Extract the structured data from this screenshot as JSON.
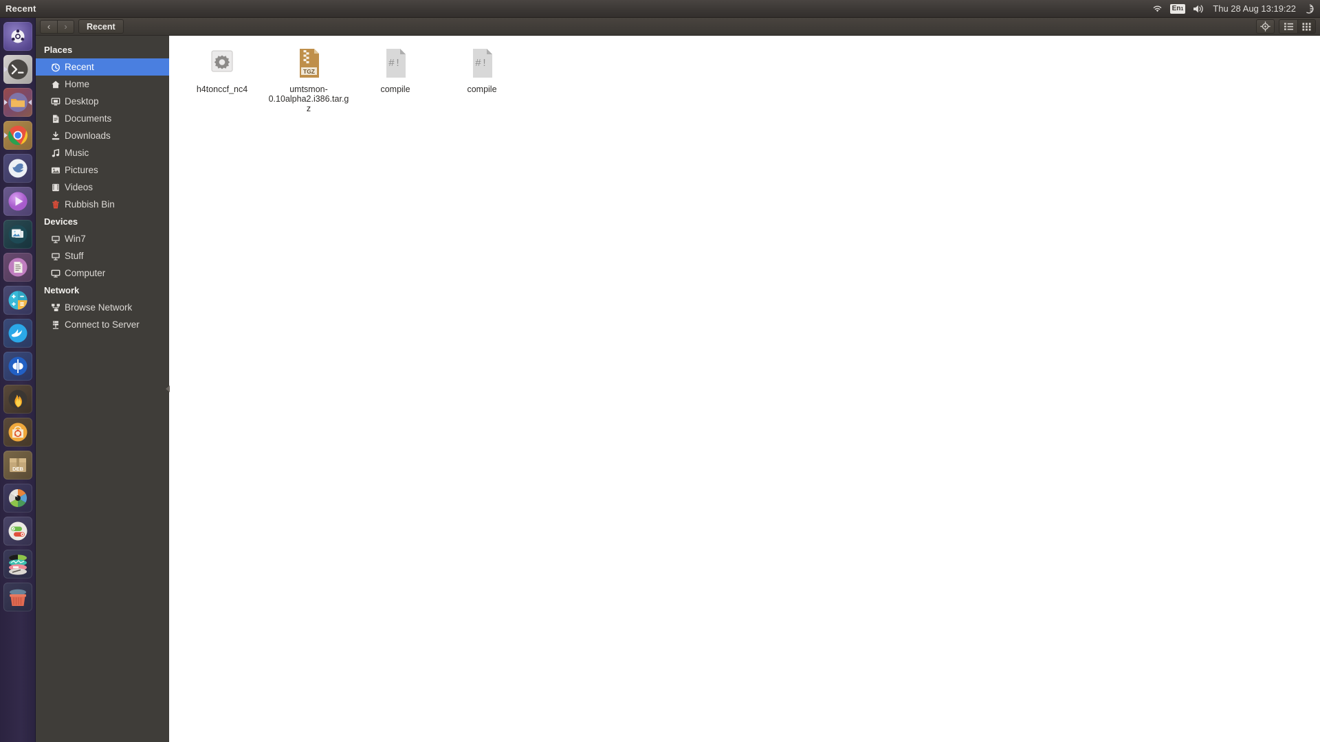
{
  "panel": {
    "title": "Recent",
    "tray": {
      "wifi_icon": "wifi-icon",
      "keyboard_label": "En",
      "keyboard_sub": "1",
      "volume_icon": "volume-icon",
      "clock": "Thu 28 Aug 13:19:22",
      "power_icon": "power-icon"
    }
  },
  "toolbar": {
    "back_label": "‹",
    "forward_label": "›",
    "path_label": "Recent",
    "search_icon": "location-search-icon",
    "list_view_icon": "list-view-icon",
    "grid_view_icon": "grid-view-icon"
  },
  "sidebar": {
    "sections": [
      {
        "header": "Places",
        "items": [
          {
            "label": "Recent",
            "icon": "clock-icon",
            "selected": true
          },
          {
            "label": "Home",
            "icon": "home-icon",
            "selected": false
          },
          {
            "label": "Desktop",
            "icon": "desktop-icon",
            "selected": false
          },
          {
            "label": "Documents",
            "icon": "document-icon",
            "selected": false
          },
          {
            "label": "Downloads",
            "icon": "download-icon",
            "selected": false
          },
          {
            "label": "Music",
            "icon": "music-note-icon",
            "selected": false
          },
          {
            "label": "Pictures",
            "icon": "picture-icon",
            "selected": false
          },
          {
            "label": "Videos",
            "icon": "film-icon",
            "selected": false
          },
          {
            "label": "Rubbish Bin",
            "icon": "trash-icon",
            "selected": false
          }
        ]
      },
      {
        "header": "Devices",
        "items": [
          {
            "label": "Win7",
            "icon": "drive-icon",
            "selected": false
          },
          {
            "label": "Stuff",
            "icon": "drive-icon",
            "selected": false
          },
          {
            "label": "Computer",
            "icon": "computer-icon",
            "selected": false
          }
        ]
      },
      {
        "header": "Network",
        "items": [
          {
            "label": "Browse Network",
            "icon": "network-icon",
            "selected": false
          },
          {
            "label": "Connect to Server",
            "icon": "server-icon",
            "selected": false
          }
        ]
      }
    ]
  },
  "files": [
    {
      "name": "h4tonccf_nc4",
      "icon": "executable-gear-icon",
      "type": "executable"
    },
    {
      "name": "umtsmon-0.10alpha2.i386.tar.gz",
      "icon": "archive-tgz-icon",
      "type": "archive",
      "badge": "TGZ"
    },
    {
      "name": "compile",
      "icon": "shell-script-icon",
      "type": "script",
      "badge": "#!"
    },
    {
      "name": "compile",
      "icon": "shell-script-icon",
      "type": "script",
      "badge": "#!"
    }
  ],
  "launcher": {
    "items": [
      {
        "name": "ubuntu-dash",
        "running": false,
        "pinned": false
      },
      {
        "name": "terminal",
        "running": true,
        "pinned": false
      },
      {
        "name": "files-nautilus",
        "running": true,
        "pinned": true
      },
      {
        "name": "google-chrome",
        "running": true,
        "pinned": false
      },
      {
        "name": "firefox-browser",
        "running": false,
        "pinned": false
      },
      {
        "name": "media-player",
        "running": false,
        "pinned": false
      },
      {
        "name": "image-viewer",
        "running": false,
        "pinned": false
      },
      {
        "name": "text-editor",
        "running": false,
        "pinned": false
      },
      {
        "name": "calculator",
        "running": false,
        "pinned": false
      },
      {
        "name": "dolphin-file-manager",
        "running": false,
        "pinned": false
      },
      {
        "name": "qbittorrent",
        "running": false,
        "pinned": false
      },
      {
        "name": "brasero-disc-burner",
        "running": false,
        "pinned": false
      },
      {
        "name": "ubuntu-software",
        "running": false,
        "pinned": false
      },
      {
        "name": "deb-package-installer",
        "running": false,
        "pinned": false
      },
      {
        "name": "color-wheel-app",
        "running": false,
        "pinned": false
      },
      {
        "name": "system-settings",
        "running": false,
        "pinned": false
      },
      {
        "name": "workspace-switcher",
        "running": false,
        "pinned": false
      },
      {
        "name": "rubbish-bin",
        "running": false,
        "pinned": false
      }
    ]
  },
  "colors": {
    "panel_bg": "#3d3936",
    "launcher_bg": "#2b2340",
    "sidebar_bg": "#3f3d39",
    "selection_blue": "#4a7fe0",
    "content_bg": "#ffffff",
    "archive_orange": "#bf8f4a"
  }
}
